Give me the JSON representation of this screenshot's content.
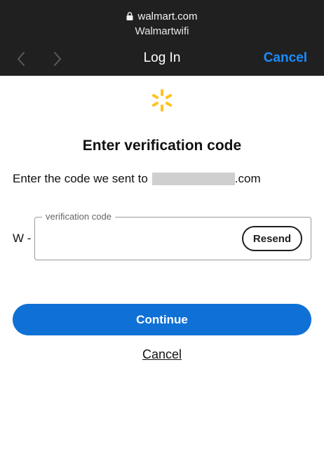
{
  "browser": {
    "url": "walmart.com",
    "site_name": "Walmartwifi",
    "title": "Log In",
    "cancel_label": "Cancel"
  },
  "page": {
    "heading": "Enter verification code",
    "sent_prefix": "Enter the code we sent to",
    "email_suffix": ".com",
    "code_prefix": "W -",
    "field_label": "verification code",
    "field_value": "",
    "resend_label": "Resend",
    "continue_label": "Continue",
    "cancel_label": "Cancel"
  },
  "colors": {
    "topbar": "#202020",
    "accent_link": "#1a8cff",
    "primary_button": "#0f71d6",
    "spark": "#ffc220"
  },
  "icons": [
    "lock-icon",
    "back-arrow-icon",
    "forward-arrow-icon",
    "walmart-spark-icon"
  ]
}
